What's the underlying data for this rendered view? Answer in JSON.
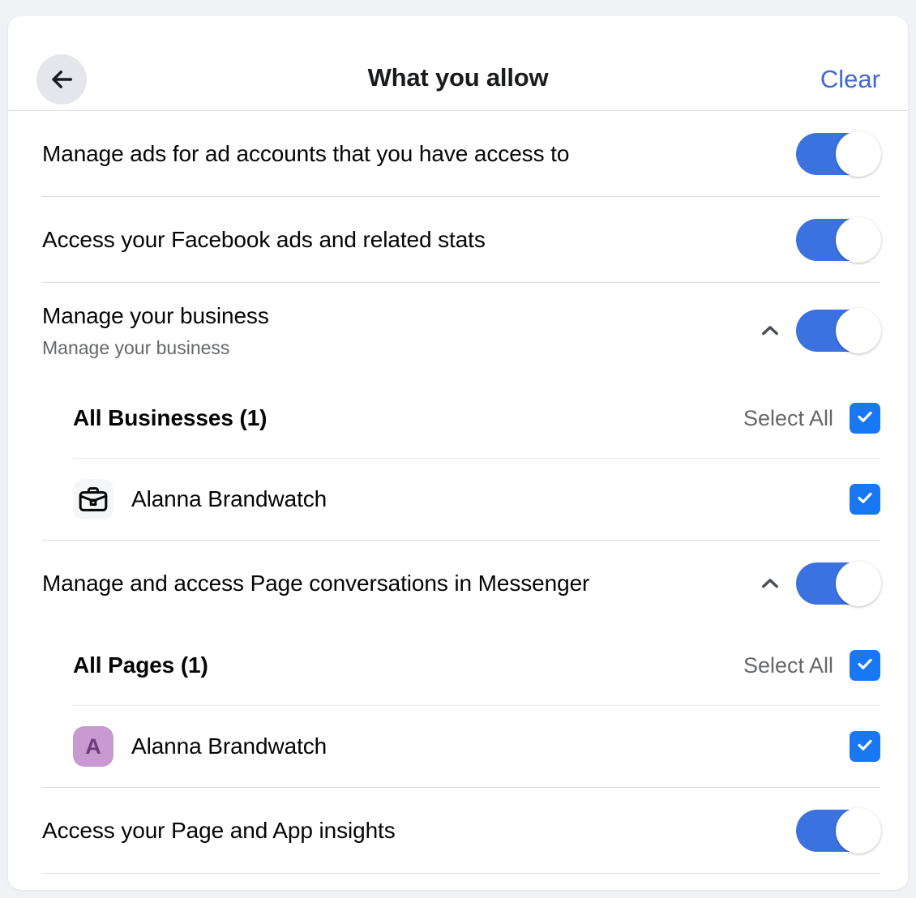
{
  "page": {
    "background_color": "#f0f2f5",
    "card_background": "#ffffff"
  },
  "header": {
    "title": "What you allow",
    "back_icon": "arrow-left-icon",
    "clear_label": "Clear",
    "clear_color": "#4267d4"
  },
  "colors": {
    "toggle_on": "#3b72e0",
    "checkbox_on": "#1877f2",
    "divider": "#d8dadd",
    "divider_nested": "#eaebed",
    "muted_text": "#65676b",
    "primary_text": "#050505",
    "avatar_bg": "#c99ad1",
    "avatar_fg": "#6b3d7a"
  },
  "permissions": [
    {
      "title": "Manage ads for ad accounts that you have access to",
      "subtitle": null,
      "toggle": {
        "state": "on",
        "label": "on"
      },
      "expandable": false
    },
    {
      "title": "Access your Facebook ads and related stats",
      "subtitle": null,
      "toggle": {
        "state": "on",
        "label": "on"
      },
      "expandable": false
    },
    {
      "title": "Manage your business",
      "subtitle": "Manage your business",
      "toggle": {
        "state": "on",
        "label": "on"
      },
      "expandable": true,
      "chevron_icon": "chevron-up-icon",
      "group": {
        "heading": "All Businesses (1)",
        "select_all_label": "Select All",
        "select_all_checked": true,
        "entities": [
          {
            "name": "Alanna Brandwatch",
            "icon": "briefcase-icon",
            "avatar_letter": null,
            "checked": true
          }
        ]
      }
    },
    {
      "title": "Manage and access Page conversations in Messenger",
      "subtitle": null,
      "toggle": {
        "state": "on",
        "label": "on"
      },
      "expandable": true,
      "chevron_icon": "chevron-up-icon",
      "group": {
        "heading": "All Pages (1)",
        "select_all_label": "Select All",
        "select_all_checked": true,
        "entities": [
          {
            "name": "Alanna Brandwatch",
            "icon": "page-avatar",
            "avatar_letter": "A",
            "checked": true
          }
        ]
      }
    },
    {
      "title": "Access your Page and App insights",
      "subtitle": null,
      "toggle": {
        "state": "on",
        "label": "on"
      },
      "expandable": false
    }
  ]
}
